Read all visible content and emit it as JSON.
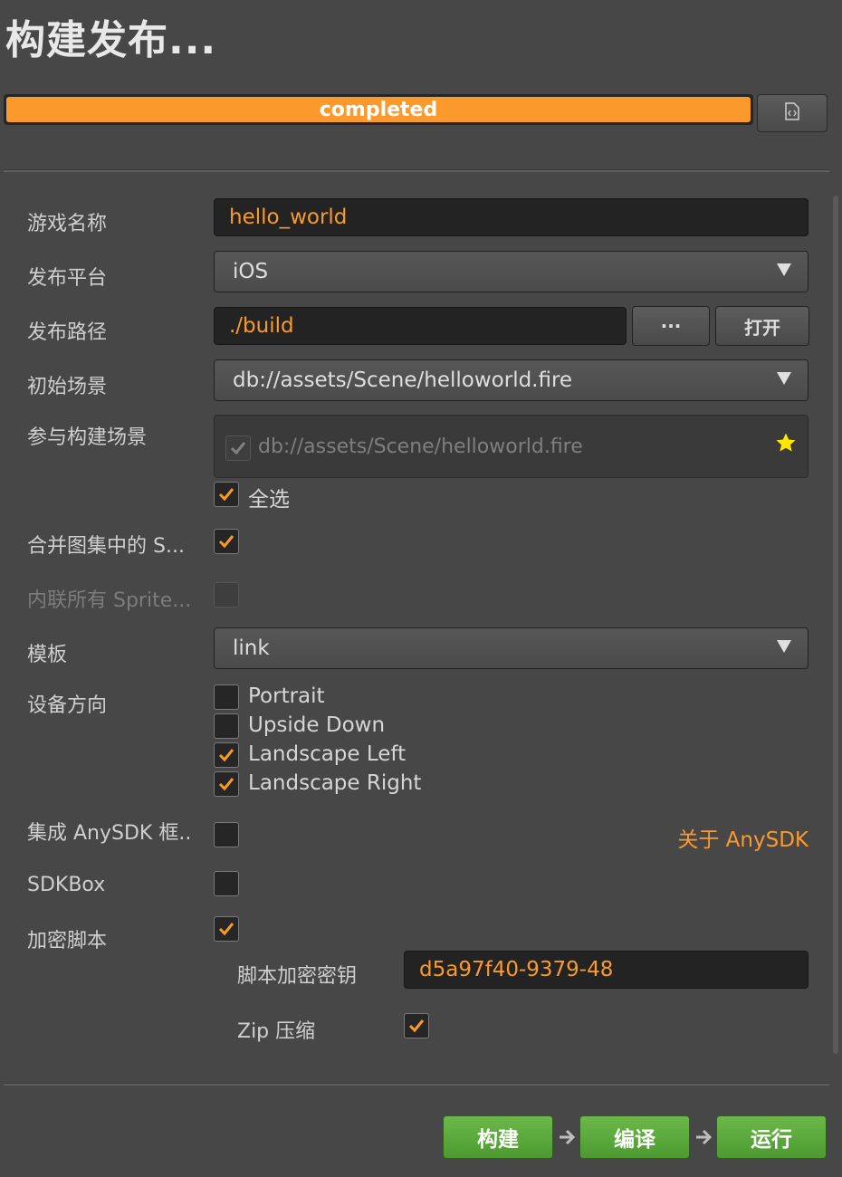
{
  "title": "构建发布...",
  "progress": {
    "label": "completed",
    "value": 1.0
  },
  "fields": {
    "game_name": {
      "label": "游戏名称",
      "value": "hello_world"
    },
    "platform": {
      "label": "发布平台",
      "value": "iOS"
    },
    "build_path": {
      "label": "发布路径",
      "value": "./build",
      "browse_label": "···",
      "open_label": "打开"
    },
    "start_scene": {
      "label": "初始场景",
      "value": "db://assets/Scene/helloworld.fire"
    },
    "included_scenes": {
      "label": "参与构建场景",
      "items": [
        "db://assets/Scene/helloworld.fire"
      ],
      "select_all_label": "全选"
    },
    "merge_atlas": {
      "label": "合并图集中的 S..."
    },
    "inline_sprite": {
      "label": "内联所有 Sprite..."
    },
    "template": {
      "label": "模板",
      "value": "link"
    },
    "orientation": {
      "label": "设备方向",
      "options": [
        "Portrait",
        "Upside Down",
        "Landscape Left",
        "Landscape Right"
      ]
    },
    "anysdk": {
      "label": "集成 AnySDK 框..",
      "link": "关于 AnySDK"
    },
    "sdkbox": {
      "label": "SDKBox"
    },
    "encrypt": {
      "label": "加密脚本",
      "key_label": "脚本加密密钥",
      "key_value": "d5a97f40-9379-48",
      "zip_label": "Zip 压缩"
    }
  },
  "actions": {
    "build": "构建",
    "compile": "编译",
    "run": "运行"
  },
  "colors": {
    "accent": "#fb9a2c",
    "green": "#5aa83a",
    "background": "#474747"
  }
}
